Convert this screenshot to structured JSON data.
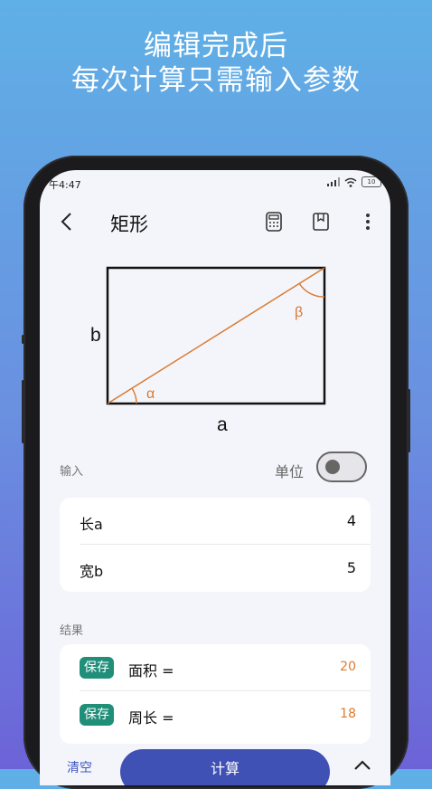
{
  "headline": {
    "line1": "编辑完成后",
    "line2": "每次计算只需输入参数"
  },
  "status_bar": {
    "time": "午4:47",
    "battery": "10"
  },
  "toolbar": {
    "title": "矩形"
  },
  "diagram": {
    "label_a": "a",
    "label_b": "b",
    "label_alpha": "α",
    "label_beta": "β"
  },
  "input_section": {
    "label": "输入",
    "unit_label": "单位",
    "unit_toggle_on": false,
    "rows": [
      {
        "label": "长a",
        "value": "4"
      },
      {
        "label": "宽b",
        "value": "5"
      }
    ]
  },
  "result_section": {
    "label": "结果",
    "save_label": "保存",
    "rows": [
      {
        "label": "面积 =",
        "value": "20"
      },
      {
        "label": "周长 =",
        "value": "18"
      }
    ]
  },
  "bottom_bar": {
    "clear_label": "清空",
    "calc_label": "计算"
  },
  "colors": {
    "accent": "#3f51b5",
    "save_badge": "#1f8f7a",
    "result_value": "#e07a2d",
    "diagonal": "#d9782e"
  }
}
